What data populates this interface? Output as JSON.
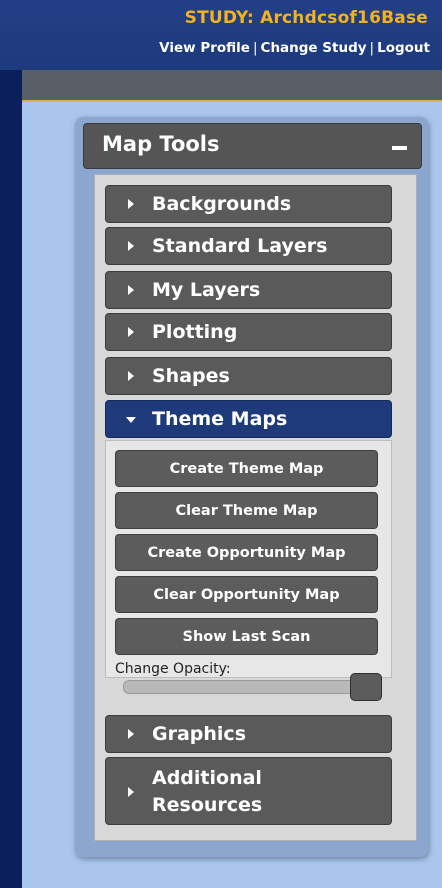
{
  "header": {
    "study": "STUDY: Archdcsof16Base",
    "view_profile": "View Profile",
    "change_study": "Change Study",
    "logout": "Logout",
    "separator": "|"
  },
  "panel": {
    "title": "Map Tools",
    "collapse_icon": "minus-icon",
    "sections": {
      "backgrounds": "Backgrounds",
      "standard_layers": "Standard Layers",
      "my_layers": "My Layers",
      "plotting": "Plotting",
      "shapes": "Shapes",
      "theme_maps": "Theme Maps",
      "graphics": "Graphics",
      "additional_resources": "Additional Resources"
    },
    "theme_maps": {
      "create_theme_map": "Create Theme Map",
      "clear_theme_map": "Clear Theme Map",
      "create_opportunity_map": "Create Opportunity Map",
      "clear_opportunity_map": "Clear Opportunity Map",
      "show_last_scan": "Show Last Scan",
      "opacity_label": "Change Opacity:",
      "opacity_value": 1.0
    }
  },
  "colors": {
    "accent_gold": "#f4b21c",
    "active_section": "#1f3a7a",
    "button_gray": "#5a5a5a"
  }
}
